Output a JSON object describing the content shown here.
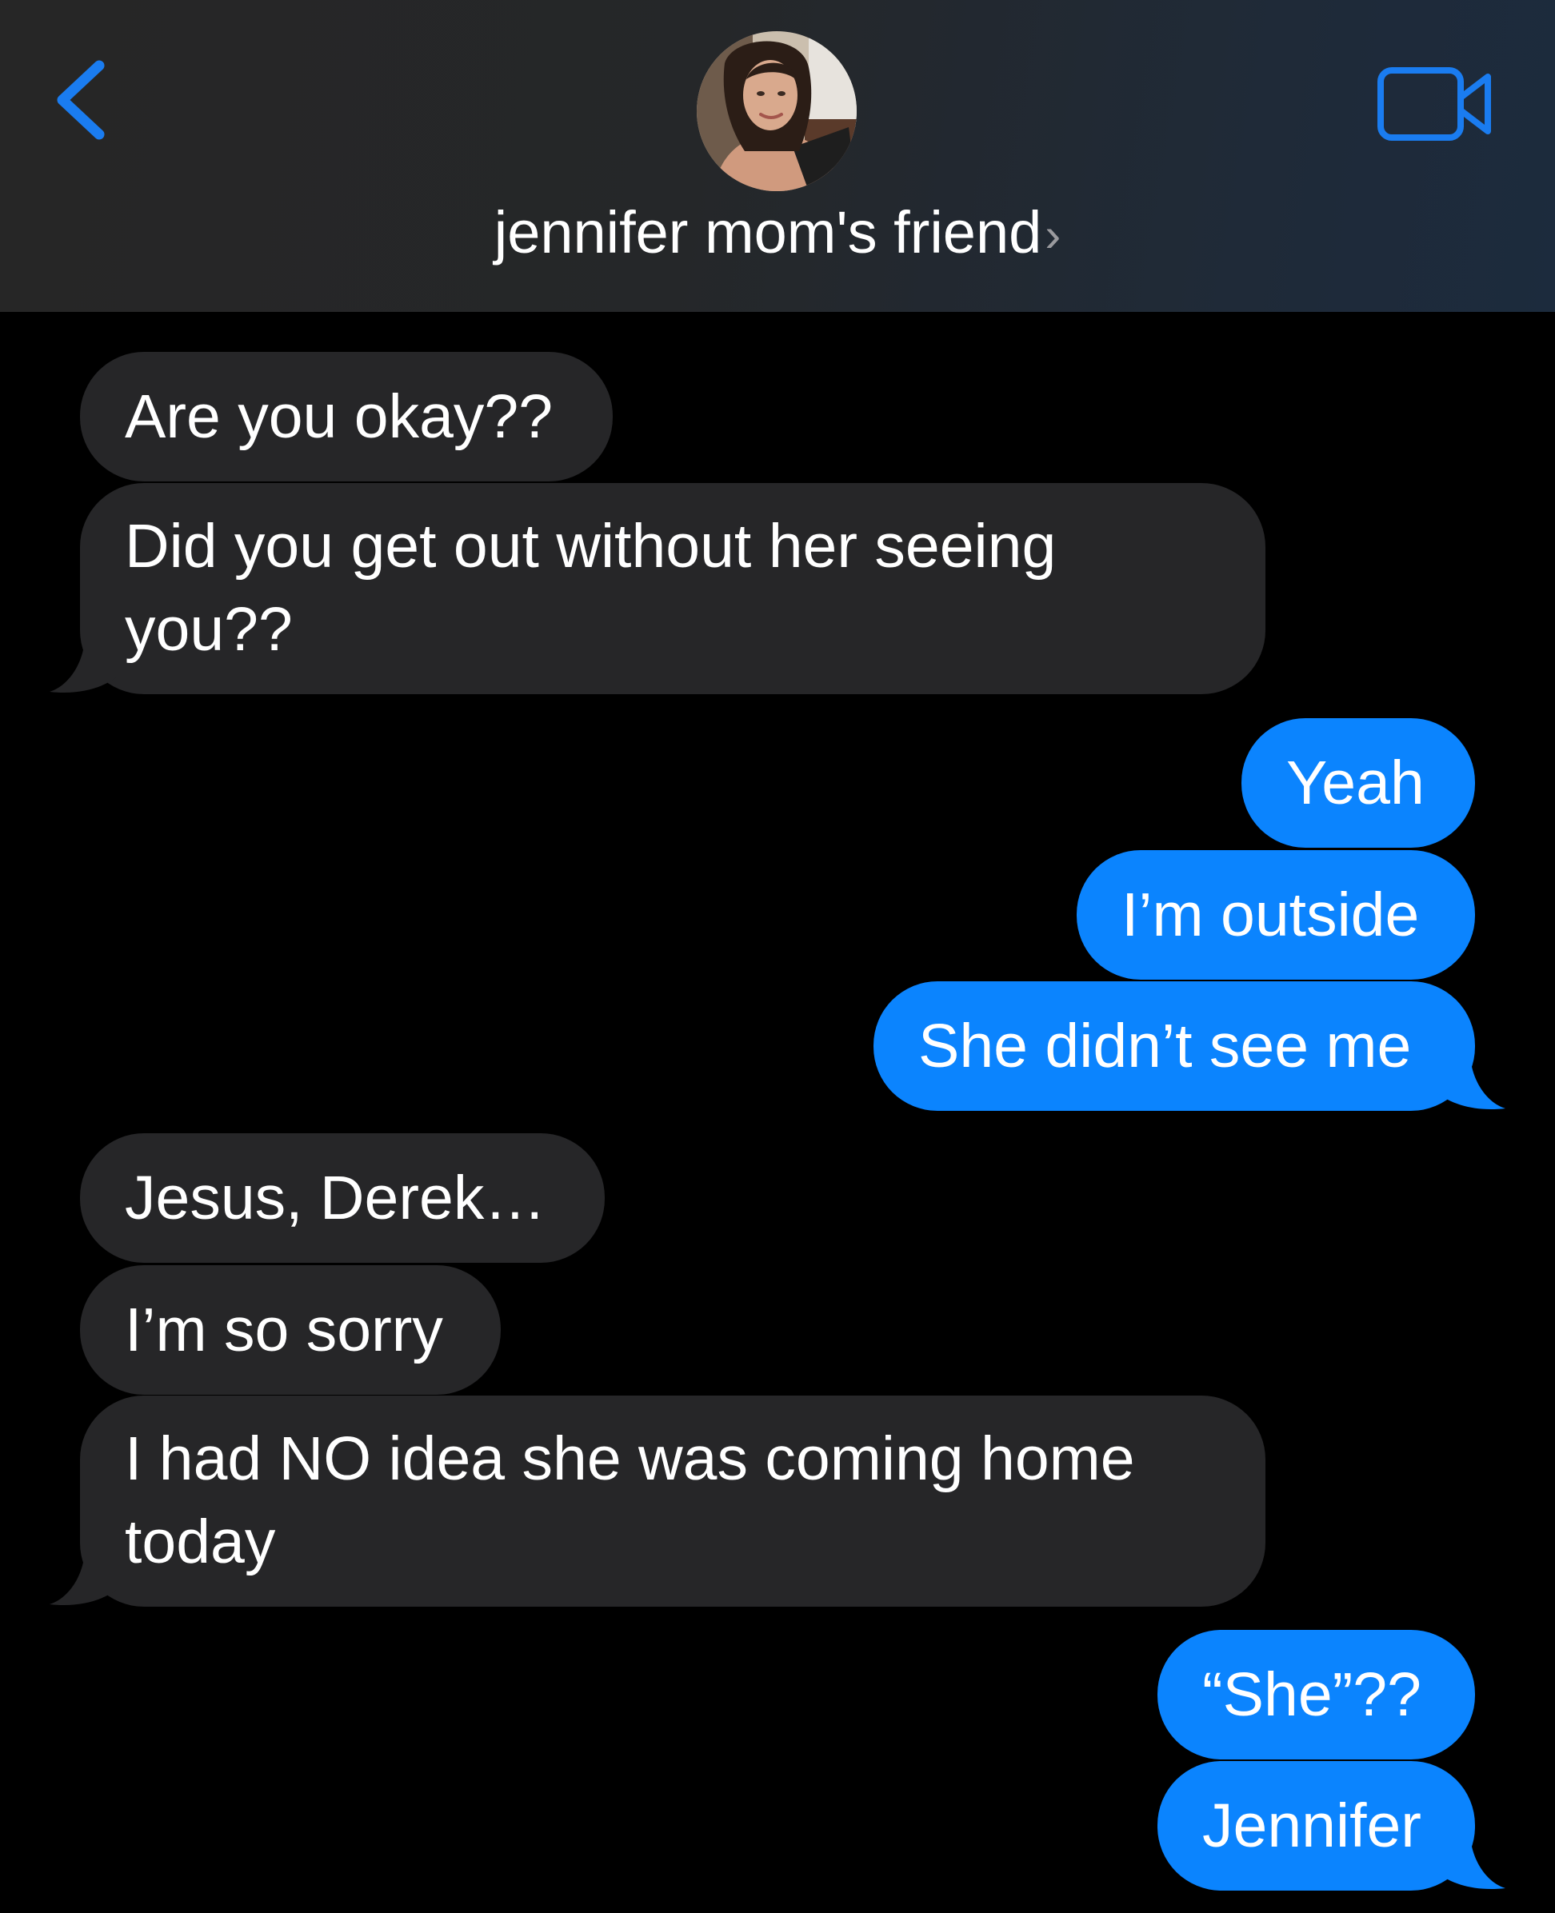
{
  "header": {
    "back_icon": "chevron-left-icon",
    "contact_name": "jennifer mom's friend",
    "contact_chevron": "›",
    "video_icon": "video-camera-icon",
    "accent_color": "#1a7cf0"
  },
  "messages": [
    {
      "direction": "incoming",
      "text": "Are you okay??"
    },
    {
      "direction": "incoming",
      "text": "Did you get out without her seeing you??"
    },
    {
      "direction": "outgoing",
      "text": "Yeah"
    },
    {
      "direction": "outgoing",
      "text": "I’m outside"
    },
    {
      "direction": "outgoing",
      "text": "She didn’t see me"
    },
    {
      "direction": "incoming",
      "text": "Jesus, Derek…"
    },
    {
      "direction": "incoming",
      "text": "I’m so sorry"
    },
    {
      "direction": "incoming",
      "text": "I had NO idea she was coming home today"
    },
    {
      "direction": "outgoing",
      "text": "“She”??"
    },
    {
      "direction": "outgoing",
      "text": "Jennifer"
    }
  ],
  "colors": {
    "incoming_bubble": "#262628",
    "outgoing_bubble": "#0b84fe",
    "background": "#000000"
  }
}
